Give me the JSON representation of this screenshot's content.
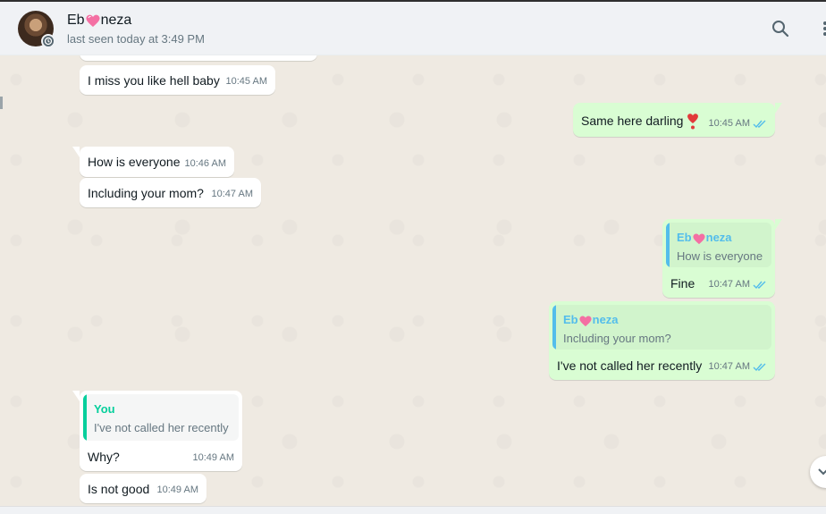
{
  "header": {
    "contact_name_prefix": "Eb",
    "contact_name_suffix": "neza",
    "last_seen": "last seen today at 3:49 PM"
  },
  "icons": {
    "header": [
      "avatar",
      "status-icon",
      "search-icon",
      "menu-icon"
    ],
    "message": [
      "double-check-icon",
      "heart-emoji",
      "pink-heart-emoji"
    ]
  },
  "colors": {
    "incoming_bubble": "#ffffff",
    "outgoing_bubble": "#d9fdd3",
    "quote_name_outgoing": "#53bdeb",
    "quote_name_incoming": "#06cf9c",
    "read_ticks": "#53bdeb"
  },
  "messages": [
    {
      "dir": "in",
      "text": "I miss you like hell baby",
      "time": "10:45 AM"
    },
    {
      "dir": "out",
      "text": "Same here darling",
      "time": "10:45 AM",
      "emoji": "heart"
    },
    {
      "dir": "in",
      "text": "How is everyone",
      "time": "10:46 AM"
    },
    {
      "dir": "in",
      "text": "Including your mom?",
      "time": "10:47 AM"
    },
    {
      "dir": "out",
      "quote_name_prefix": "Eb",
      "quote_name_suffix": "neza",
      "quote_text": "How is everyone",
      "text": "Fine",
      "time": "10:47 AM"
    },
    {
      "dir": "out",
      "quote_name_prefix": "Eb",
      "quote_name_suffix": "neza",
      "quote_text": "Including your mom?",
      "text": "I've not called her recently",
      "time": "10:47 AM"
    },
    {
      "dir": "in",
      "quote_name": "You",
      "quote_text": "I've not called her recently",
      "text": "Why?",
      "time": "10:49 AM"
    },
    {
      "dir": "in",
      "text": "Is not good",
      "time": "10:49 AM"
    }
  ]
}
